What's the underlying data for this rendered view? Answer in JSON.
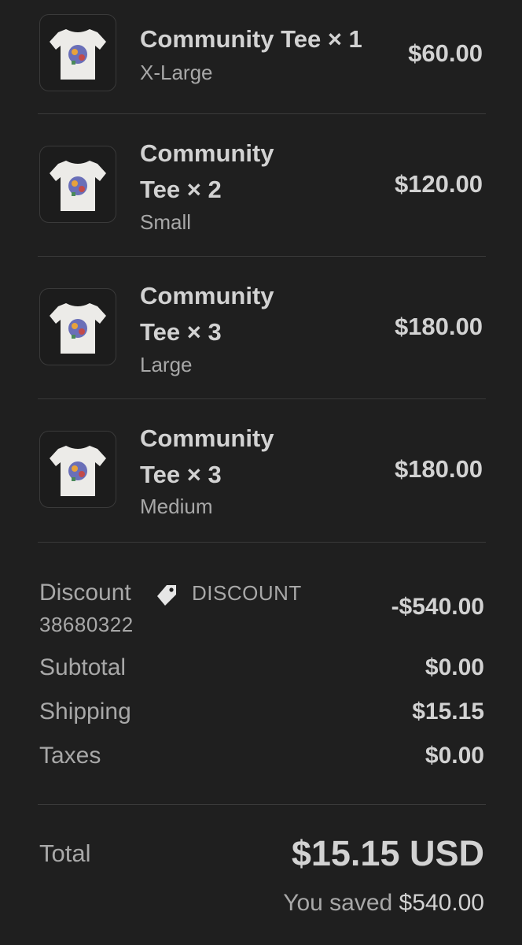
{
  "items": [
    {
      "name": "Community Tee × 1",
      "variant": "X-Large",
      "price": "$60.00",
      "image_icon": "tshirt-icon"
    },
    {
      "name_line1": "Community",
      "name_line2": "Tee × 2",
      "variant": "Small",
      "price": "$120.00",
      "image_icon": "tshirt-icon"
    },
    {
      "name_line1": "Community",
      "name_line2": "Tee × 3",
      "variant": "Large",
      "price": "$180.00",
      "image_icon": "tshirt-icon"
    },
    {
      "name_line1": "Community",
      "name_line2": "Tee × 3",
      "variant": "Medium",
      "price": "$180.00",
      "image_icon": "tshirt-icon"
    }
  ],
  "summary": {
    "discount_label": "Discount",
    "discount_code_part1": "DISCOUNT",
    "discount_code_part2": "38680322",
    "discount_value": "-$540.00",
    "subtotal_label": "Subtotal",
    "subtotal_value": "$0.00",
    "shipping_label": "Shipping",
    "shipping_value": "$15.15",
    "taxes_label": "Taxes",
    "taxes_value": "$0.00"
  },
  "total": {
    "label": "Total",
    "value": "$15.15 USD",
    "saved_label": "You saved",
    "saved_amount": "$540.00"
  },
  "colors": {
    "background": "#1f1f1f",
    "text_primary": "#d2d2d2",
    "text_secondary": "#a8a8a8",
    "divider": "#3a3a3a"
  }
}
